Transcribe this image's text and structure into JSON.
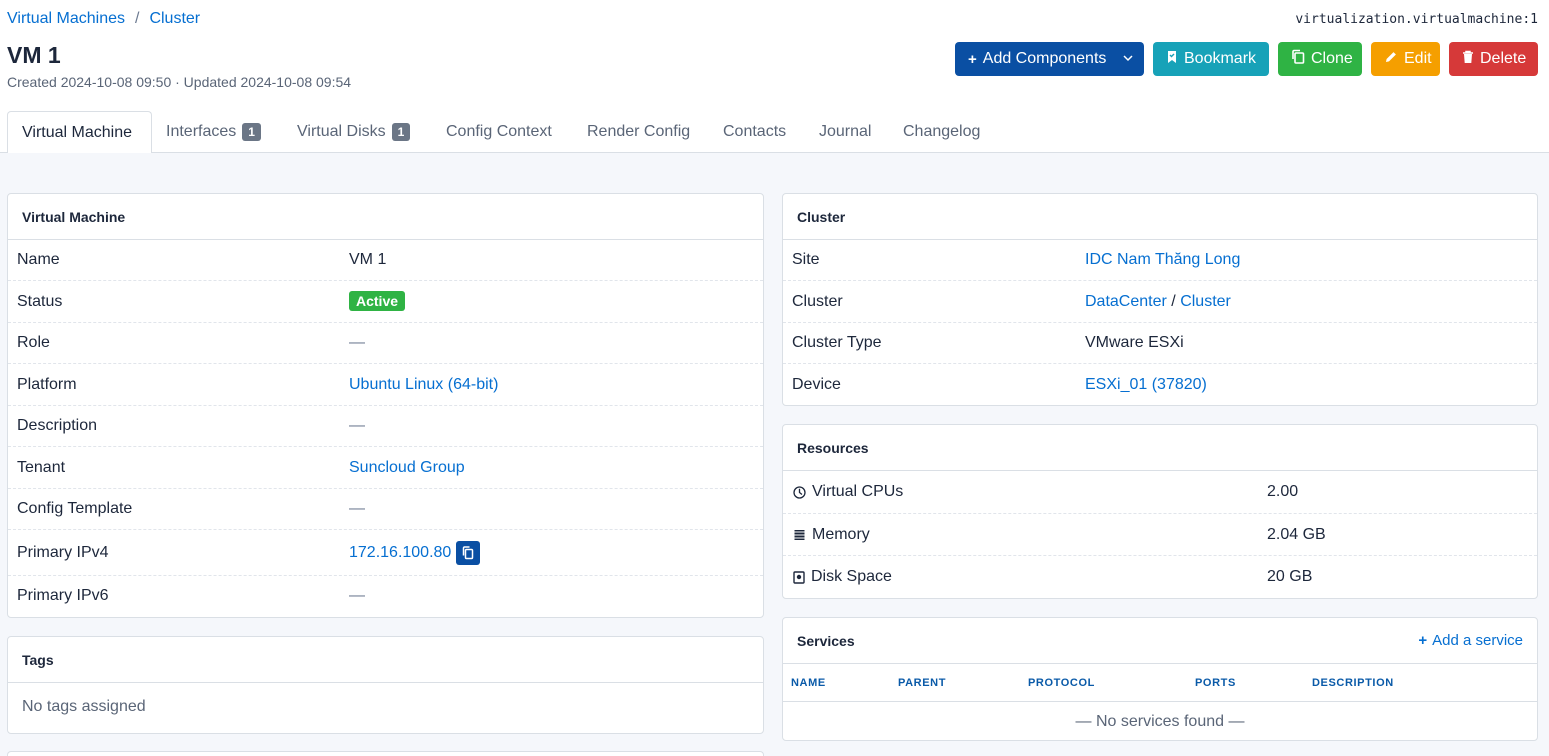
{
  "breadcrumb": {
    "item1": "Virtual Machines",
    "sep": "/",
    "item2": "Cluster"
  },
  "object_id": "virtualization.virtualmachine:1",
  "page": {
    "title": "VM 1",
    "meta": "Created 2024-10-08 09:50 · Updated 2024-10-08 09:54"
  },
  "actions": {
    "add_components": "Add Components",
    "bookmark": "Bookmark",
    "clone": "Clone",
    "edit": "Edit",
    "delete": "Delete"
  },
  "tabs": {
    "virtual_machine": "Virtual Machine",
    "interfaces": "Interfaces",
    "interfaces_count": "1",
    "virtual_disks": "Virtual Disks",
    "virtual_disks_count": "1",
    "config_context": "Config Context",
    "render_config": "Render Config",
    "contacts": "Contacts",
    "journal": "Journal",
    "changelog": "Changelog"
  },
  "vm_card": {
    "title": "Virtual Machine",
    "name_k": "Name",
    "name_v": "VM 1",
    "status_k": "Status",
    "status_v": "Active",
    "role_k": "Role",
    "role_v": "—",
    "platform_k": "Platform",
    "platform_v": "Ubuntu Linux (64-bit)",
    "description_k": "Description",
    "description_v": "—",
    "tenant_k": "Tenant",
    "tenant_v": "Suncloud Group",
    "config_template_k": "Config Template",
    "config_template_v": "—",
    "ipv4_k": "Primary IPv4",
    "ipv4_v": "172.16.100.80",
    "ipv6_k": "Primary IPv6",
    "ipv6_v": "—"
  },
  "tags_card": {
    "title": "Tags",
    "empty": "No tags assigned"
  },
  "cluster_card": {
    "title": "Cluster",
    "site_k": "Site",
    "site_v": "IDC Nam Thăng Long",
    "cluster_k": "Cluster",
    "cluster_group": "DataCenter",
    "cluster_sep": "/",
    "cluster_name": "Cluster",
    "type_k": "Cluster Type",
    "type_v": "VMware ESXi",
    "device_k": "Device",
    "device_v": "ESXi_01 (37820)"
  },
  "resources_card": {
    "title": "Resources",
    "vcpus_k": "Virtual CPUs",
    "vcpus_v": "2.00",
    "memory_k": "Memory",
    "memory_v": "2.04 GB",
    "disk_k": "Disk Space",
    "disk_v": "20 GB"
  },
  "services_card": {
    "title": "Services",
    "add": "Add a service",
    "columns": {
      "name": "NAME",
      "parent": "PARENT",
      "protocol": "PROTOCOL",
      "ports": "PORTS",
      "description": "DESCRIPTION"
    },
    "empty": "— No services found —"
  },
  "colors": {
    "primary": "#0a4fa3",
    "link": "#066fd1",
    "success": "#2fb344",
    "teal": "#17a2b8",
    "warning": "#f59f00",
    "danger": "#d63939"
  }
}
